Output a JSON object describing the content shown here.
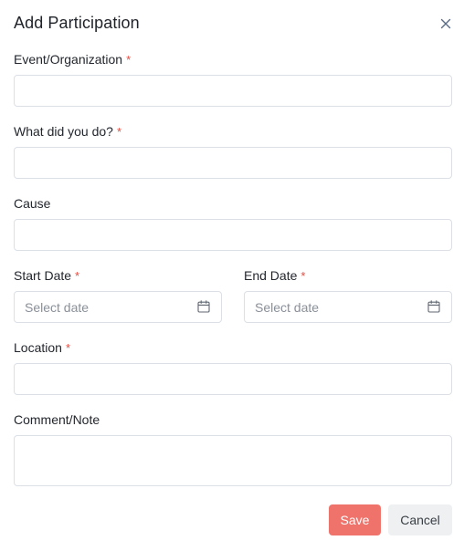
{
  "dialog": {
    "title": "Add Participation",
    "close_icon": "close-icon"
  },
  "fields": {
    "event": {
      "label": "Event/Organization",
      "required_mark": "*",
      "value": ""
    },
    "activity": {
      "label": "What did you do?",
      "required_mark": "*",
      "value": ""
    },
    "cause": {
      "label": "Cause",
      "value": ""
    },
    "start_date": {
      "label": "Start Date",
      "required_mark": "*",
      "placeholder": "Select date",
      "icon": "calendar-icon"
    },
    "end_date": {
      "label": "End Date",
      "required_mark": "*",
      "placeholder": "Select date",
      "icon": "calendar-icon"
    },
    "location": {
      "label": "Location",
      "required_mark": "*",
      "value": ""
    },
    "comment": {
      "label": "Comment/Note",
      "value": ""
    }
  },
  "actions": {
    "save_label": "Save",
    "cancel_label": "Cancel"
  },
  "colors": {
    "primary": "#f0736b",
    "required": "#e54d42",
    "secondary_button": "#eef0f2",
    "border": "#dcdfe6"
  }
}
